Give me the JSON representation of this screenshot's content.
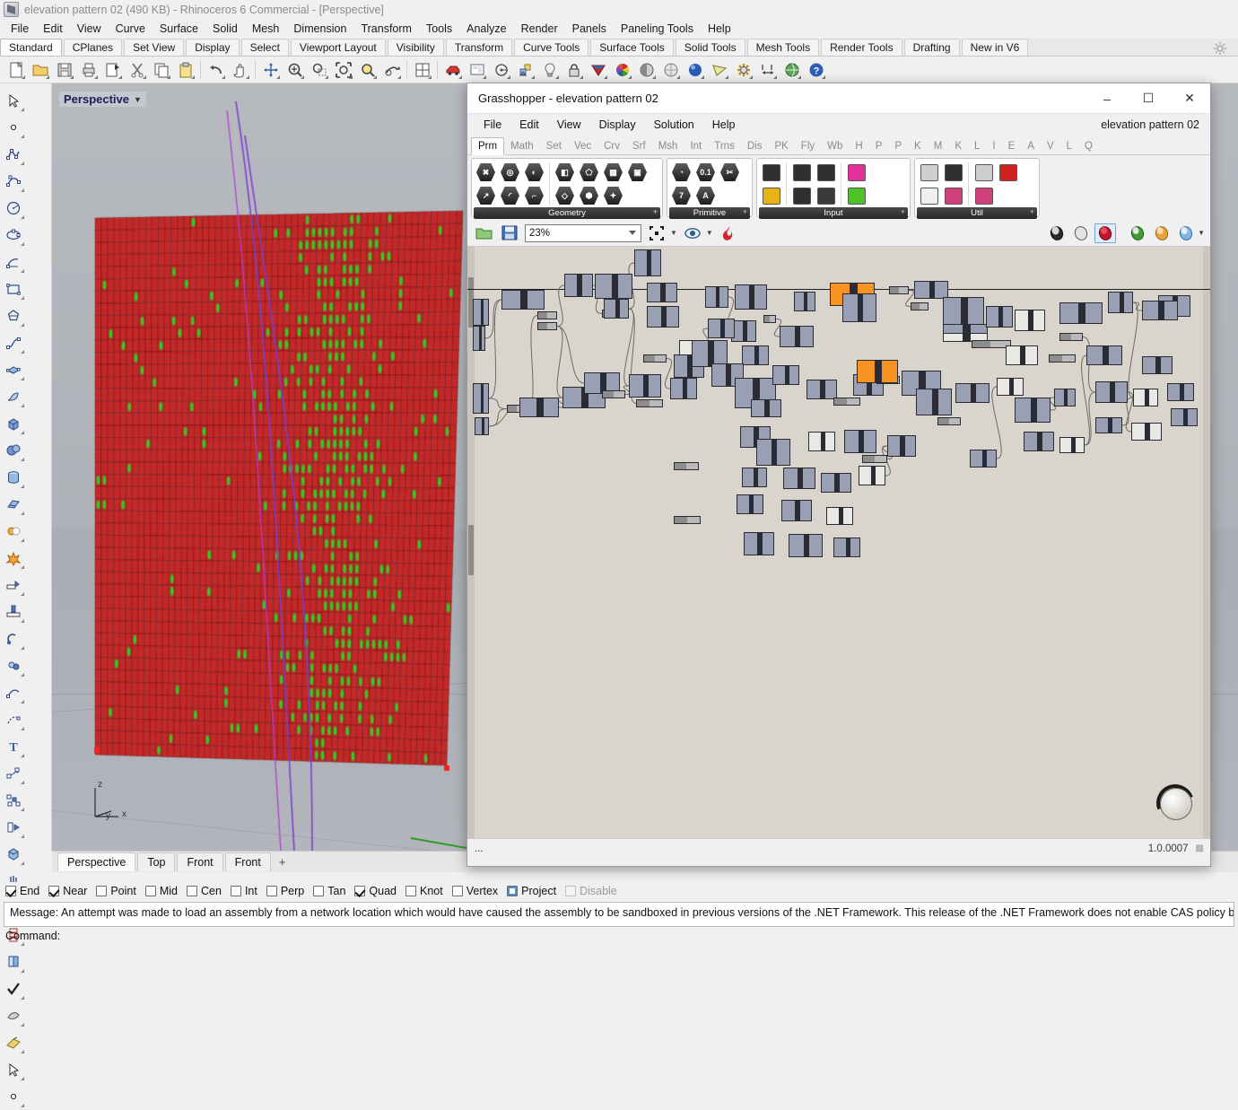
{
  "rhino": {
    "title": "elevation pattern 02 (490 KB) - Rhinoceros 6 Commercial - [Perspective]",
    "menu": [
      "File",
      "Edit",
      "View",
      "Curve",
      "Surface",
      "Solid",
      "Mesh",
      "Dimension",
      "Transform",
      "Tools",
      "Analyze",
      "Render",
      "Panels",
      "Paneling Tools",
      "Help"
    ],
    "tabs": [
      "Standard",
      "CPlanes",
      "Set View",
      "Display",
      "Select",
      "Viewport Layout",
      "Visibility",
      "Transform",
      "Curve Tools",
      "Surface Tools",
      "Solid Tools",
      "Mesh Tools",
      "Render Tools",
      "Drafting",
      "New in V6"
    ],
    "active_tab": "Standard",
    "toolbar_icons": [
      "new-file-icon",
      "open-folder-icon",
      "save-icon",
      "print-icon",
      "export-icon",
      "cut-icon",
      "copy-icon",
      "paste-icon",
      "undo-icon",
      "pan-icon",
      "rotate-view-icon",
      "zoom-in-icon",
      "zoom-window-icon",
      "zoom-extents-icon",
      "zoom-selected-icon",
      "zoom-dynamic-icon",
      "grid-icon",
      "car-icon",
      "layout-icon",
      "point-circle-icon",
      "object-snap-icon",
      "light-bulb-icon",
      "lock-icon",
      "render-mesh-icon",
      "color-wheel-icon",
      "shade-icon",
      "ghost-icon",
      "render-icon",
      "camera-icon",
      "gear-icon",
      "dimension-icon",
      "earth-icon",
      "help-icon"
    ],
    "side_icons": [
      "select-arrow-icon",
      "point-icon",
      "polyline-icon",
      "control-point-curve-icon",
      "circle-icon",
      "ellipse-icon",
      "arc-icon",
      "rectangle-icon",
      "polygon-icon",
      "curve-blend-icon",
      "surface-from-points-icon",
      "surface-sweep-icon",
      "box-icon",
      "sphere-icon",
      "cylinder-icon",
      "extrude-surface-icon",
      "boolean-union-icon",
      "explode-icon",
      "trim-icon",
      "split-icon",
      "fillet-icon",
      "chamfer-icon",
      "boolean-difference-icon",
      "boolean-intersection-icon",
      "offset-curve-icon",
      "offset-surface-icon",
      "text-icon",
      "move-icon",
      "array-icon",
      "rotate-icon",
      "box-edit-icon",
      "extrude-mesh-icon",
      "grid-array-icon",
      "stack-icon",
      "copy-object-icon",
      "check-icon",
      "mesh-icon",
      "render-material-icon"
    ],
    "viewport": {
      "label": "Perspective",
      "axis_labels": [
        "z",
        "y",
        "x"
      ]
    },
    "viewport_tabs": [
      "Perspective",
      "Top",
      "Front",
      "Front"
    ],
    "viewport_active_tab": "Perspective",
    "add_viewport_label": "+",
    "osnaps": [
      {
        "label": "End",
        "state": "checked"
      },
      {
        "label": "Near",
        "state": "checked"
      },
      {
        "label": "Point",
        "state": "unchecked"
      },
      {
        "label": "Mid",
        "state": "unchecked"
      },
      {
        "label": "Cen",
        "state": "unchecked"
      },
      {
        "label": "Int",
        "state": "unchecked"
      },
      {
        "label": "Perp",
        "state": "unchecked"
      },
      {
        "label": "Tan",
        "state": "unchecked"
      },
      {
        "label": "Quad",
        "state": "checked"
      },
      {
        "label": "Knot",
        "state": "unchecked"
      },
      {
        "label": "Vertex",
        "state": "unchecked"
      },
      {
        "label": "Project",
        "state": "square"
      },
      {
        "label": "Disable",
        "state": "disabled"
      }
    ],
    "command_message": "Message: An attempt was made to load an assembly from a network location which would have caused the assembly to be sandboxed in previous versions of the .NET Framework. This release of the .NET Framework does not enable CAS policy by default, so this",
    "command_prompt": "Command:"
  },
  "grasshopper": {
    "title": "Grasshopper - elevation pattern 02",
    "window_buttons": {
      "minimize": "–",
      "maximize": "☐",
      "close": "✕"
    },
    "menu": [
      "File",
      "Edit",
      "View",
      "Display",
      "Solution",
      "Help"
    ],
    "document_name": "elevation pattern 02",
    "tabs": [
      "Prm",
      "Math",
      "Set",
      "Vec",
      "Crv",
      "Srf",
      "Msh",
      "Int",
      "Trns",
      "Dis",
      "PK",
      "Fly",
      "Wb",
      "H",
      "P",
      "P",
      "K",
      "M",
      "K",
      "L",
      "I",
      "E",
      "A",
      "V",
      "L",
      "Q"
    ],
    "active_tab": "Prm",
    "ribbon_groups": [
      {
        "name": "Geometry",
        "expand": "+",
        "icons": [
          "geometry-point-icon",
          "circle-icon",
          "curve-icon",
          "surface-icon",
          "brep-icon",
          "mesh-icon",
          "box-icon",
          "vector-icon",
          "arc-icon",
          "line-icon",
          "plane-icon",
          "solid-icon",
          "transform-icon"
        ]
      },
      {
        "name": "Primitive",
        "expand": "+",
        "icons": [
          "boolean-icon",
          "number-icon",
          "scissors-icon",
          "integer-icon",
          "text-icon"
        ]
      },
      {
        "name": "Input",
        "expand": "+",
        "icons": [
          "file-reader-icon",
          "button-icon",
          "graph-mapper-icon",
          "gradient-icon",
          "slider-icon",
          "knob-icon",
          "value-list-icon",
          "colour-swatch-icon"
        ]
      },
      {
        "name": "Util",
        "expand": "+",
        "icons": [
          "group-icon",
          "cluster-icon",
          "arrow-right-icon",
          "cherries-icon",
          "arrow-outline-icon",
          "data-recorder-icon",
          "flask-icon"
        ]
      }
    ],
    "toolbar": {
      "open_icon": "open-file-icon",
      "save_icon": "save-file-icon",
      "zoom_value": "23%",
      "widget_icon": "sketch-widget-icon",
      "preview_icon": "preview-eye-icon",
      "bake_icon": "bake-flame-icon",
      "right_icons": [
        "preview-off-icon",
        "wireframe-preview-icon",
        "shaded-preview-icon",
        "preview-green-icon",
        "preview-orange-icon",
        "preview-blue-icon"
      ],
      "active_right_icon": "shaded-preview-icon"
    },
    "canvas": {
      "navigator_icon": "canvas-navigator-icon",
      "orange_node_count": 2
    },
    "status": {
      "left": "...",
      "version": "1.0.0007",
      "grip": "⁙"
    }
  },
  "colors": {
    "gh_canvas_bg": "#d9d5cd",
    "node_fill": "#9aa0b4",
    "node_stroke": "#2b2b33",
    "node_highlight": "#f79320",
    "viewport_bg": "#b3b7bc",
    "facade_red": "#c52828",
    "facade_green": "#35c722",
    "curve_purple": "#7a3fd0"
  }
}
